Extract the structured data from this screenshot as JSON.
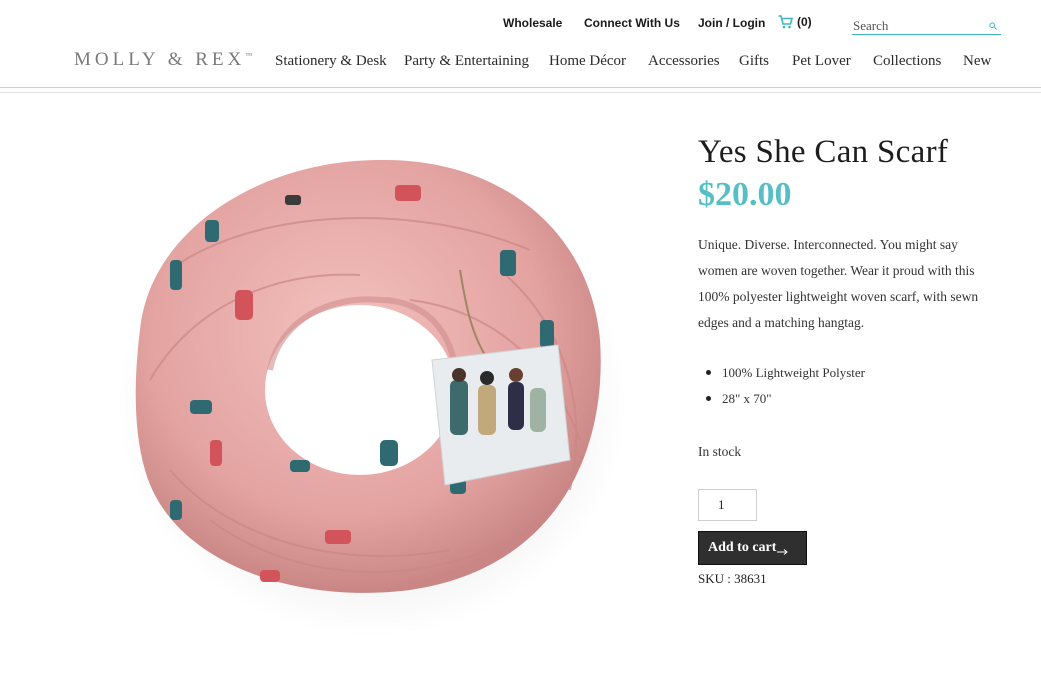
{
  "header": {
    "utility_links": [
      "Wholesale",
      "Connect With Us",
      "Join / Login"
    ],
    "cart_label": "(0)",
    "search_placeholder": "Search",
    "logo_text": "MOLLY & REX",
    "logo_tm": "™",
    "nav": [
      "Stationery & Desk",
      "Party & Entertaining",
      "Home Décor",
      "Accessories",
      "Gifts",
      "Pet Lover",
      "Collections",
      "New"
    ]
  },
  "product": {
    "title": "Yes She Can Scarf",
    "price": "$20.00",
    "description": "Unique. Diverse. Interconnected. You might say women are woven together. Wear it proud with this 100% polyester lightweight woven scarf, with sewn edges and a matching hangtag.",
    "features": [
      "100% Lightweight Polyster",
      "28\" x 70\""
    ],
    "stock_status": "In stock",
    "quantity": "1",
    "add_to_cart_label": "Add to cart",
    "sku": "SKU : 38631"
  },
  "colors": {
    "accent": "#56bfc5",
    "scarf_pink": "#e7a9a9",
    "button_bg": "#2f2f2f"
  },
  "icons": {
    "cart": "cart-icon",
    "search": "search-icon",
    "arrow": "arrow-right-icon"
  }
}
